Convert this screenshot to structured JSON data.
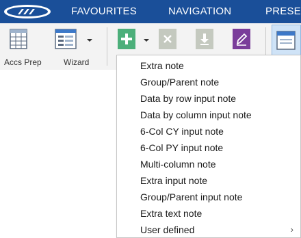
{
  "menubar": {
    "items": [
      "FAVOURITES",
      "NAVIGATION",
      "PRESEN"
    ]
  },
  "ribbon": {
    "accs_prep_label": "Accs Prep",
    "wizard_label": "Wizard"
  },
  "dropdown": {
    "items": [
      "Extra note",
      "Group/Parent note",
      "Data by row input note",
      "Data by column input note",
      "6-Col CY input note",
      "6-Col PY input note",
      "Multi-column note",
      "Extra input note",
      "Group/Parent input note",
      "Extra text note",
      "User defined"
    ],
    "submenu_arrow": "›"
  },
  "colors": {
    "menubar_bg": "#1a4f99",
    "add_green": "#4caf7a",
    "edit_purple": "#7a3d9a"
  }
}
